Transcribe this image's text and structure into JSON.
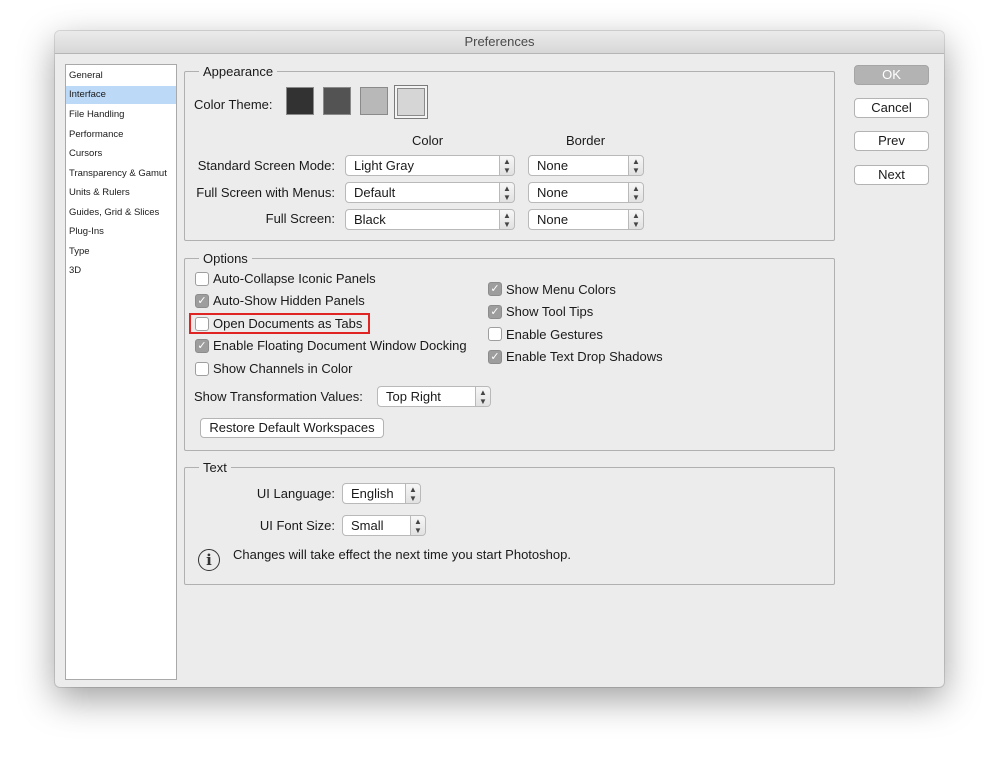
{
  "window": {
    "title": "Preferences"
  },
  "sidebar": {
    "selected": "Interface",
    "items": [
      {
        "label": "General"
      },
      {
        "label": "Interface"
      },
      {
        "label": "File Handling"
      },
      {
        "label": "Performance"
      },
      {
        "label": "Cursors"
      },
      {
        "label": "Transparency & Gamut"
      },
      {
        "label": "Units & Rulers"
      },
      {
        "label": "Guides, Grid & Slices"
      },
      {
        "label": "Plug-Ins"
      },
      {
        "label": "Type"
      },
      {
        "label": "3D"
      }
    ]
  },
  "appearance": {
    "title": "Appearance",
    "color_theme_label": "Color Theme:",
    "themes": [
      {
        "name": "darkest",
        "color": "#323232"
      },
      {
        "name": "dark",
        "color": "#535353"
      },
      {
        "name": "medium",
        "color": "#b8b8b8"
      },
      {
        "name": "light",
        "color": "#d6d6d6",
        "selected": true
      }
    ],
    "col_color": "Color",
    "col_border": "Border",
    "modes": [
      {
        "label": "Standard Screen Mode:",
        "color": "Light Gray",
        "border": "None"
      },
      {
        "label": "Full Screen with Menus:",
        "color": "Default",
        "border": "None"
      },
      {
        "label": "Full Screen:",
        "color": "Black",
        "border": "None"
      }
    ]
  },
  "options": {
    "title": "Options",
    "left": [
      {
        "label": "Auto-Collapse Iconic Panels",
        "checked": false
      },
      {
        "label": "Auto-Show Hidden Panels",
        "checked": true
      },
      {
        "label": "Open Documents as Tabs",
        "checked": false
      },
      {
        "label": "Enable Floating Document Window Docking",
        "checked": true
      },
      {
        "label": "Show Channels in Color",
        "checked": false
      }
    ],
    "right": [
      {
        "label": "Show Menu Colors",
        "checked": true
      },
      {
        "label": "Show Tool Tips",
        "checked": true
      },
      {
        "label": "Enable Gestures",
        "checked": false
      },
      {
        "label": "Enable Text Drop Shadows",
        "checked": true
      }
    ],
    "transform_label": "Show Transformation Values:",
    "transform_value": "Top Right",
    "restore_button": "Restore Default Workspaces"
  },
  "text": {
    "title": "Text",
    "ui_language_label": "UI Language:",
    "ui_language_value": "English",
    "ui_font_size_label": "UI Font Size:",
    "ui_font_size_value": "Small",
    "info_message": "Changes will take effect the next time you start Photoshop."
  },
  "buttons": {
    "ok": "OK",
    "cancel": "Cancel",
    "prev": "Prev",
    "next": "Next"
  },
  "colors": {
    "selection": "#bcd9f7",
    "highlight": "#e02424"
  }
}
